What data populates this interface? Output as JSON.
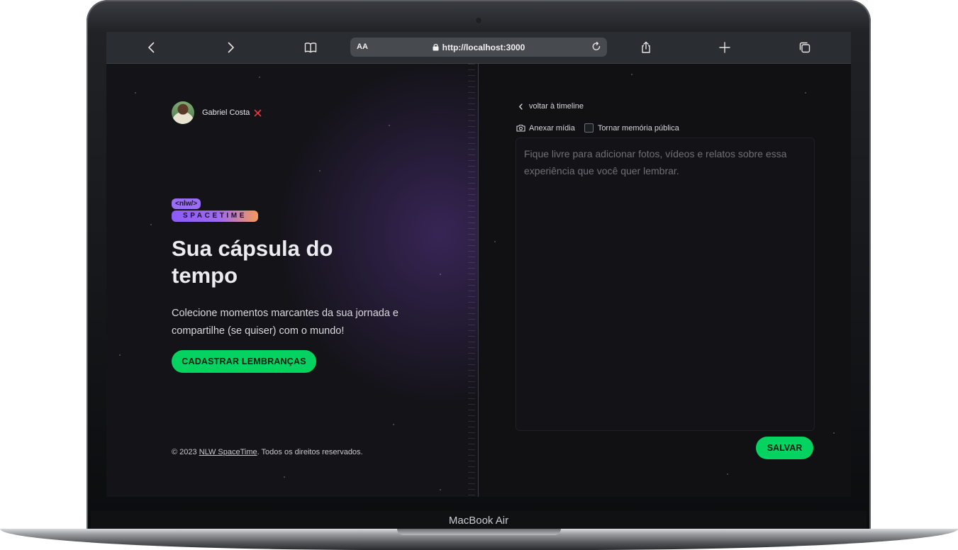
{
  "device": {
    "label": "MacBook Air"
  },
  "browser": {
    "text_size_label": "AA",
    "url": "http://localhost:3000",
    "icons": [
      "chevron-left-icon",
      "chevron-right-icon",
      "book-icon",
      "lock-icon",
      "reload-icon",
      "share-icon",
      "plus-icon",
      "tabs-icon"
    ]
  },
  "user": {
    "name": "Gabriel Costa"
  },
  "logo": {
    "top": "<nlw/>",
    "bottom": "SPACETIME"
  },
  "hero": {
    "title": "Sua cápsula do tempo",
    "subtitle": "Colecione momentos marcantes da sua jornada e compartilhe (se quiser) com o mundo!",
    "cta_label": "CADASTRAR LEMBRANÇAS"
  },
  "footer": {
    "prefix": "© 2023 ",
    "link": "NLW SpaceTime",
    "suffix": ". Todos os direitos reservados."
  },
  "editor": {
    "back_label": "voltar à timeline",
    "attach_label": "Anexar mídia",
    "public_label": "Tornar memória pública",
    "public_checked": false,
    "placeholder": "Fique livre para adicionar fotos, vídeos e relatos sobre essa experiência que você quer lembrar.",
    "save_label": "SALVAR"
  },
  "colors": {
    "accent_green": "#04d361",
    "purple": "#8b5cf6",
    "orange": "#f59a5b",
    "background": "#121215"
  }
}
